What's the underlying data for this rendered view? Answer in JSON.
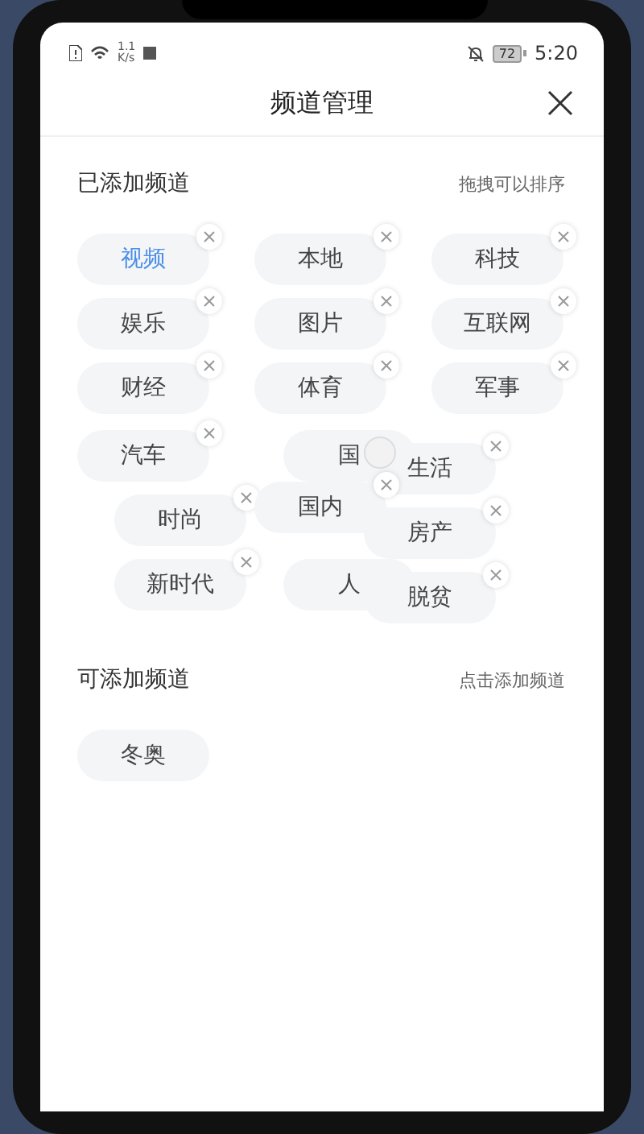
{
  "status_bar": {
    "net_speed": "1.1\nK/s",
    "battery": "72",
    "time": "5:20"
  },
  "header": {
    "title": "频道管理"
  },
  "added": {
    "title": "已添加频道",
    "hint": "拖拽可以排序",
    "channels": [
      {
        "label": "视频",
        "selected": true,
        "removable": true
      },
      {
        "label": "本地",
        "selected": false,
        "removable": true
      },
      {
        "label": "科技",
        "selected": false,
        "removable": true
      },
      {
        "label": "娱乐",
        "selected": false,
        "removable": true
      },
      {
        "label": "图片",
        "selected": false,
        "removable": true
      },
      {
        "label": "互联网",
        "selected": false,
        "removable": true
      },
      {
        "label": "财经",
        "selected": false,
        "removable": true
      },
      {
        "label": "体育",
        "selected": false,
        "removable": true
      },
      {
        "label": "军事",
        "selected": false,
        "removable": true
      }
    ],
    "moving_channels": [
      {
        "label": "汽车",
        "selected": false,
        "removable": true
      },
      {
        "label": "国",
        "selected": false,
        "removable": false
      },
      {
        "label": "人",
        "selected": false,
        "removable": false
      },
      {
        "label": "时尚",
        "selected": false,
        "removable": true
      },
      {
        "label": "新时代",
        "selected": false,
        "removable": true
      },
      {
        "label": "生活",
        "selected": false,
        "removable": true
      },
      {
        "label": "房产",
        "selected": false,
        "removable": true
      },
      {
        "label": "脱贫",
        "selected": false,
        "removable": true
      },
      {
        "label": "国内",
        "selected": false,
        "removable": true
      }
    ]
  },
  "available": {
    "title": "可添加频道",
    "hint": "点击添加频道",
    "channels": [
      {
        "label": "冬奥",
        "selected": false,
        "removable": false
      }
    ]
  }
}
